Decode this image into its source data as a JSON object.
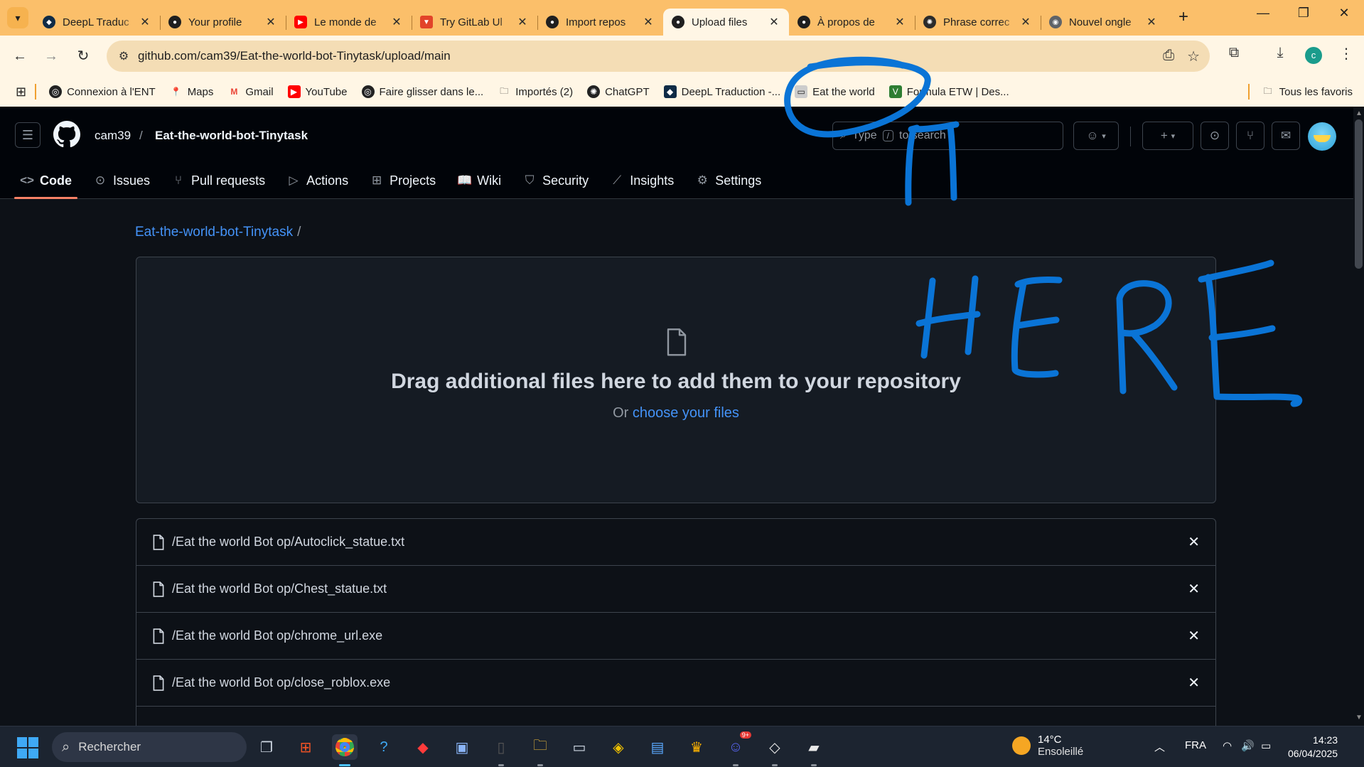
{
  "browser": {
    "tabs": [
      {
        "title": "DeepL Traduc",
        "favicon": "deepl-icon",
        "active": false
      },
      {
        "title": "Your profile",
        "favicon": "github-icon",
        "active": false
      },
      {
        "title": "Le monde de",
        "favicon": "youtube-icon",
        "active": false
      },
      {
        "title": "Try GitLab Ul",
        "favicon": "gitlab-icon",
        "active": false
      },
      {
        "title": "Import repos",
        "favicon": "github-icon",
        "active": false
      },
      {
        "title": "Upload files",
        "favicon": "github-icon",
        "active": true
      },
      {
        "title": "À propos de",
        "favicon": "github-icon",
        "active": false
      },
      {
        "title": "Phrase correc",
        "favicon": "chatgpt-icon",
        "active": false
      },
      {
        "title": "Nouvel ongle",
        "favicon": "chrome-icon",
        "active": false
      }
    ],
    "url": "github.com/cam39/Eat-the-world-bot-Tinytask/upload/main",
    "profile_initial": "c",
    "bookmarks": [
      {
        "label": "Connexion à l'ENT",
        "icon": "globe-icon"
      },
      {
        "label": "Maps",
        "icon": "maps-pin-icon"
      },
      {
        "label": "Gmail",
        "icon": "gmail-icon"
      },
      {
        "label": "YouTube",
        "icon": "youtube-icon"
      },
      {
        "label": "Faire glisser dans le...",
        "icon": "globe-icon"
      },
      {
        "label": "Importés (2)",
        "icon": "folder-icon"
      },
      {
        "label": "ChatGPT",
        "icon": "chatgpt-icon"
      },
      {
        "label": "DeepL Traduction -...",
        "icon": "deepl-icon"
      },
      {
        "label": "Eat the world",
        "icon": "page-icon"
      },
      {
        "label": "Formula ETW | Des...",
        "icon": "formula-icon"
      }
    ],
    "all_bookmarks_label": "Tous les favoris",
    "colors": {
      "tabstrip": "#fbbf6a",
      "toolbar": "#fff6e5",
      "omnibox": "#f4ddb5"
    }
  },
  "github": {
    "owner": "cam39",
    "repo": "Eat-the-world-bot-Tinytask",
    "search_placeholder_pre": "Type",
    "search_key": "/",
    "search_placeholder_post": "to search",
    "nav": [
      {
        "label": "Code",
        "icon": "code-icon",
        "active": true
      },
      {
        "label": "Issues",
        "icon": "issue-icon",
        "active": false
      },
      {
        "label": "Pull requests",
        "icon": "pull-request-icon",
        "active": false
      },
      {
        "label": "Actions",
        "icon": "play-icon",
        "active": false
      },
      {
        "label": "Projects",
        "icon": "table-icon",
        "active": false
      },
      {
        "label": "Wiki",
        "icon": "book-icon",
        "active": false
      },
      {
        "label": "Security",
        "icon": "shield-icon",
        "active": false
      },
      {
        "label": "Insights",
        "icon": "graph-icon",
        "active": false
      },
      {
        "label": "Settings",
        "icon": "gear-icon",
        "active": false
      }
    ],
    "breadcrumb_repo": "Eat-the-world-bot-Tinytask",
    "breadcrumb_sep": "/",
    "dropzone": {
      "title": "Drag additional files here to add them to your repository",
      "sub_prefix": "Or",
      "sub_link": "choose your files"
    },
    "files": [
      "/Eat the world Bot op/Autoclick_statue.txt",
      "/Eat the world Bot op/Chest_statue.txt",
      "/Eat the world Bot op/chrome_url.exe",
      "/Eat the world Bot op/close_roblox.exe"
    ],
    "colors": {
      "link": "#4493f8",
      "active_tab_underline": "#f78166"
    }
  },
  "annotation": {
    "text": "HERE",
    "color": "#0a74d6"
  },
  "taskbar": {
    "search_label": "Rechercher",
    "weather_temp": "14°C",
    "weather_desc": "Ensoleillé",
    "language": "FRA",
    "time": "14:23",
    "date": "06/04/2025",
    "discord_badge": "9+"
  }
}
